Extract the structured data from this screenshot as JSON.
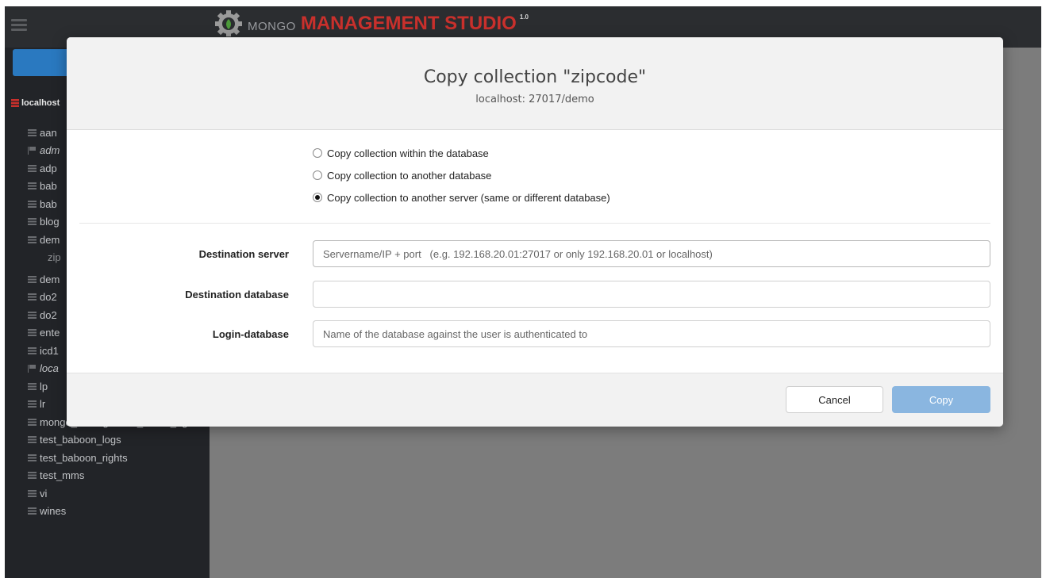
{
  "brand": {
    "prefix": "MONGO",
    "main": "MANAGEMENT STUDIO",
    "version": "1.0"
  },
  "sidebar": {
    "server_label": "localhost",
    "databases": [
      {
        "label": "aan",
        "icon": "database-icon",
        "italic": false
      },
      {
        "label": "adm",
        "icon": "flag-icon",
        "italic": true
      },
      {
        "label": "adp",
        "icon": "database-icon",
        "italic": false
      },
      {
        "label": "bab",
        "icon": "database-icon",
        "italic": false
      },
      {
        "label": "bab",
        "icon": "database-icon",
        "italic": false
      },
      {
        "label": "blog",
        "icon": "database-icon",
        "italic": false
      },
      {
        "label": "dem",
        "icon": "database-icon",
        "italic": false
      },
      {
        "label": "zip",
        "icon": "collection",
        "italic": false
      },
      {
        "label": "dem",
        "icon": "database-icon",
        "italic": false
      },
      {
        "label": "do2",
        "icon": "database-icon",
        "italic": false
      },
      {
        "label": "do2",
        "icon": "database-icon",
        "italic": false
      },
      {
        "label": "ente",
        "icon": "database-icon",
        "italic": false
      },
      {
        "label": "icd1",
        "icon": "database-icon",
        "italic": false
      },
      {
        "label": "loca",
        "icon": "flag-icon",
        "italic": true
      },
      {
        "label": "lp",
        "icon": "database-icon",
        "italic": false
      },
      {
        "label": "lr",
        "icon": "database-icon",
        "italic": false
      },
      {
        "label": "mongo_management_studio_rig",
        "icon": "database-icon",
        "italic": false
      },
      {
        "label": "test_baboon_logs",
        "icon": "database-icon",
        "italic": false
      },
      {
        "label": "test_baboon_rights",
        "icon": "database-icon",
        "italic": false
      },
      {
        "label": "test_mms",
        "icon": "database-icon",
        "italic": false
      },
      {
        "label": "vi",
        "icon": "database-icon",
        "italic": false
      },
      {
        "label": "wines",
        "icon": "database-icon",
        "italic": false
      }
    ]
  },
  "modal": {
    "title": "Copy collection \"zipcode\"",
    "subtitle": "localhost: 27017/demo",
    "options": [
      {
        "label": "Copy collection within the database",
        "checked": false
      },
      {
        "label": "Copy collection to another database",
        "checked": false
      },
      {
        "label": "Copy collection to another server (same or different database)",
        "checked": true
      }
    ],
    "fields": {
      "destination_server": {
        "label": "Destination server",
        "value": "",
        "placeholder": "Servername/IP + port   (e.g. 192.168.20.01:27017 or only 192.168.20.01 or localhost)"
      },
      "destination_database": {
        "label": "Destination database",
        "value": "",
        "placeholder": ""
      },
      "login_database": {
        "label": "Login-database",
        "value": "",
        "placeholder": "Name of the database against the user is authenticated to"
      }
    },
    "buttons": {
      "cancel": "Cancel",
      "copy": "Copy"
    }
  },
  "colors": {
    "brand_red": "#c9302c",
    "primary_blue": "#2a79c0",
    "copy_button": "#8ab6e0",
    "sidebar_bg": "#222428"
  }
}
